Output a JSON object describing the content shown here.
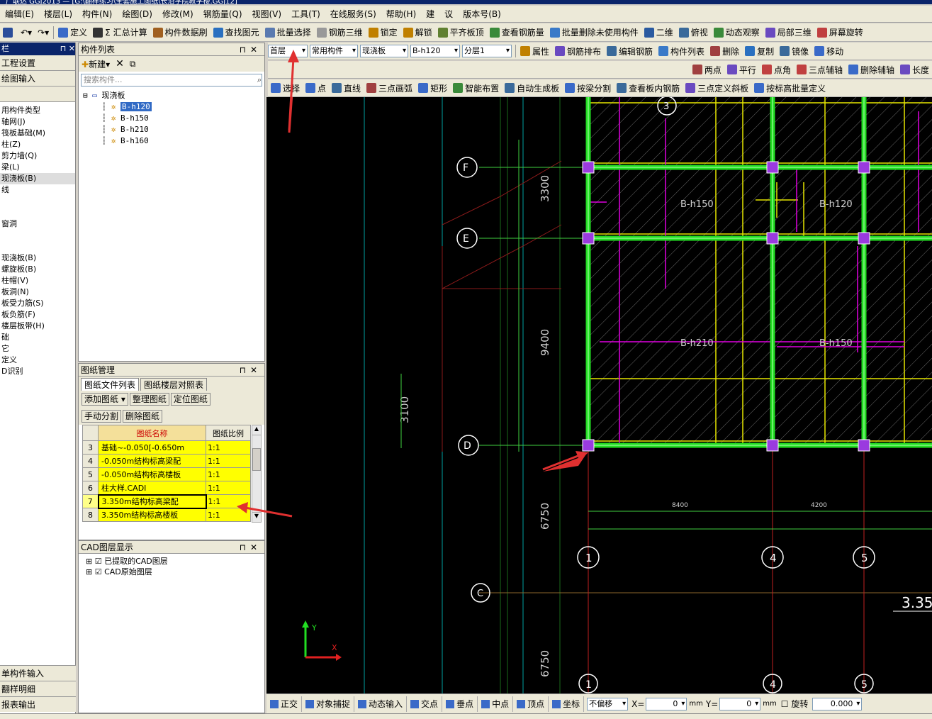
{
  "window": {
    "title": "广联达 GGJ2013 — [G:\\翻样练习\\全套施工图纸\\长沿学院教学楼.GGJ12]"
  },
  "menu": [
    "编辑(E)",
    "楼层(L)",
    "构件(N)",
    "绘图(D)",
    "修改(M)",
    "钢筋量(Q)",
    "视图(V)",
    "工具(T)",
    "在线服务(S)",
    "帮助(H)",
    "建",
    "议",
    "版本号(B)"
  ],
  "toolbar": {
    "items": [
      "定义",
      "Σ 汇总计算",
      "构件数据刷",
      "查找图元",
      "批量选择",
      "钢筋三维",
      "锁定",
      "解锁",
      "平齐板顶",
      "查看钢筋量",
      "批量删除未使用构件",
      "二维",
      "俯视",
      "动态观察",
      "局部三维",
      "屏幕旋转"
    ]
  },
  "leftnav": {
    "header": "栏",
    "buttons": [
      "工程设置",
      "绘图输入"
    ],
    "items": [
      "用构件类型",
      "轴网(J)",
      "筏板基础(M)",
      "柱(Z)",
      "剪力墙(Q)",
      "梁(L)",
      "现浇板(B)",
      "线",
      "",
      "",
      "窗洞",
      "",
      "",
      "现浇板(B)",
      "螺旋板(B)",
      "柱帽(V)",
      "板洞(N)",
      "板受力筋(S)",
      "板负筋(F)",
      "楼层板带(H)",
      "础",
      "它",
      "定义",
      "D识别"
    ],
    "selected_index": 6,
    "bottom": [
      "单构件输入",
      "翻样明细",
      "报表输出"
    ]
  },
  "component_list": {
    "title": "构件列表",
    "new_label": "新建",
    "search_placeholder": "搜索构件...",
    "root": "现浇板",
    "items": [
      "B-h120",
      "B-h150",
      "B-h210",
      "B-h160"
    ],
    "selected": "B-h120"
  },
  "drawing_mgr": {
    "title": "图纸管理",
    "tabs": [
      "图纸文件列表",
      "图纸楼层对照表"
    ],
    "buttons_row1": [
      "添加图纸",
      "整理图纸",
      "定位图纸"
    ],
    "buttons_row2": [
      "手动分割",
      "删除图纸"
    ],
    "col_name": "图纸名称",
    "col_scale": "图纸比例",
    "rows": [
      {
        "n": "3",
        "name": "基础~-0.050[-0.650m",
        "scale": "1:1"
      },
      {
        "n": "4",
        "name": "-0.050m结构标高梁配",
        "scale": "1:1"
      },
      {
        "n": "5",
        "name": "-0.050m结构标高楼板",
        "scale": "1:1"
      },
      {
        "n": "6",
        "name": "柱大样.CADI",
        "scale": "1:1"
      },
      {
        "n": "7",
        "name": "3.350m结构标高梁配",
        "scale": "1:1"
      },
      {
        "n": "8",
        "name": "3.350m结构标高楼板",
        "scale": "1:1"
      }
    ],
    "current_row": "7"
  },
  "cad_layers": {
    "title": "CAD图层显示",
    "items": [
      "已提取的CAD图层",
      "CAD原始图层"
    ]
  },
  "draw_toolbar1": {
    "floor": "首层",
    "type": "常用构件",
    "category": "现浇板",
    "component": "B-h120",
    "layer": "分层1",
    "actions": [
      "属性",
      "钢筋排布",
      "编辑钢筋",
      "构件列表",
      "删除",
      "复制",
      "镜像",
      "移动"
    ]
  },
  "draw_toolbar2": [
    "两点",
    "平行",
    "点角",
    "三点辅轴",
    "删除辅轴",
    "长度"
  ],
  "draw_toolbar3": [
    "选择",
    "点",
    "直线",
    "三点画弧",
    "矩形",
    "智能布置",
    "自动生成板",
    "按梁分割",
    "查看板内钢筋",
    "三点定义斜板",
    "按标高批量定义"
  ],
  "canvas": {
    "axis_labels": {
      "F": "F",
      "E": "E",
      "D": "D",
      "C": "C",
      "a1": "1",
      "a4": "4",
      "a5": "5",
      "a3": "3"
    },
    "dims": {
      "d3300": "3300",
      "d9400": "9400",
      "d3100": "3100",
      "d6750a": "6750",
      "d6750b": "6750",
      "d8400": "8400",
      "d4200": "4200",
      "elev": "3.35"
    },
    "slabs": {
      "s1": "B-h150",
      "s2": "B-h120",
      "s3": "B-h210",
      "s4": "B-h150"
    }
  },
  "status": {
    "items": [
      "正交",
      "对象捕捉",
      "动态输入",
      "交点",
      "垂点",
      "中点",
      "顶点",
      "坐标"
    ],
    "offset": "不偏移",
    "x_label": "X=",
    "x": "0",
    "y_label": "Y=",
    "y": "0",
    "unit": "mm",
    "rotate": "旋转",
    "angle": "0.000"
  }
}
